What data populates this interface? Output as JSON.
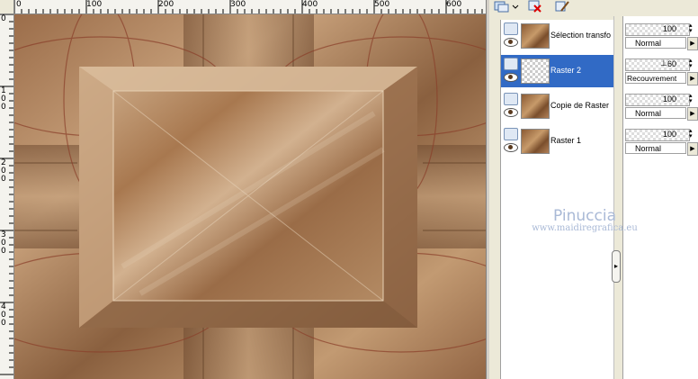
{
  "ruler": {
    "top_labels": [
      "0",
      "100",
      "200",
      "300",
      "400",
      "500",
      "600"
    ],
    "left_labels": [
      "0",
      "1\n0\n0",
      "2\n0\n0",
      "3\n0\n0",
      "4\n0\n0"
    ]
  },
  "layers": [
    {
      "name": "Sélection transfo",
      "thumb": "brown",
      "selected": false
    },
    {
      "name": "Raster 2",
      "thumb": "checker",
      "selected": true
    },
    {
      "name": "Copie de Raster",
      "thumb": "brown",
      "selected": false
    },
    {
      "name": "Raster 1",
      "thumb": "brown",
      "selected": false
    }
  ],
  "layer_props": [
    {
      "opacity": "100",
      "blend": "Normal"
    },
    {
      "opacity": "60",
      "blend": "Recouvrement"
    },
    {
      "opacity": "100",
      "blend": "Normal"
    },
    {
      "opacity": "100",
      "blend": "Normal"
    }
  ],
  "watermark": {
    "line1": "Pinuccia",
    "line2": "www.maidiregrafica.eu"
  },
  "colors": {
    "selection": "#316ac5",
    "canvas_base": "#a37a56"
  }
}
